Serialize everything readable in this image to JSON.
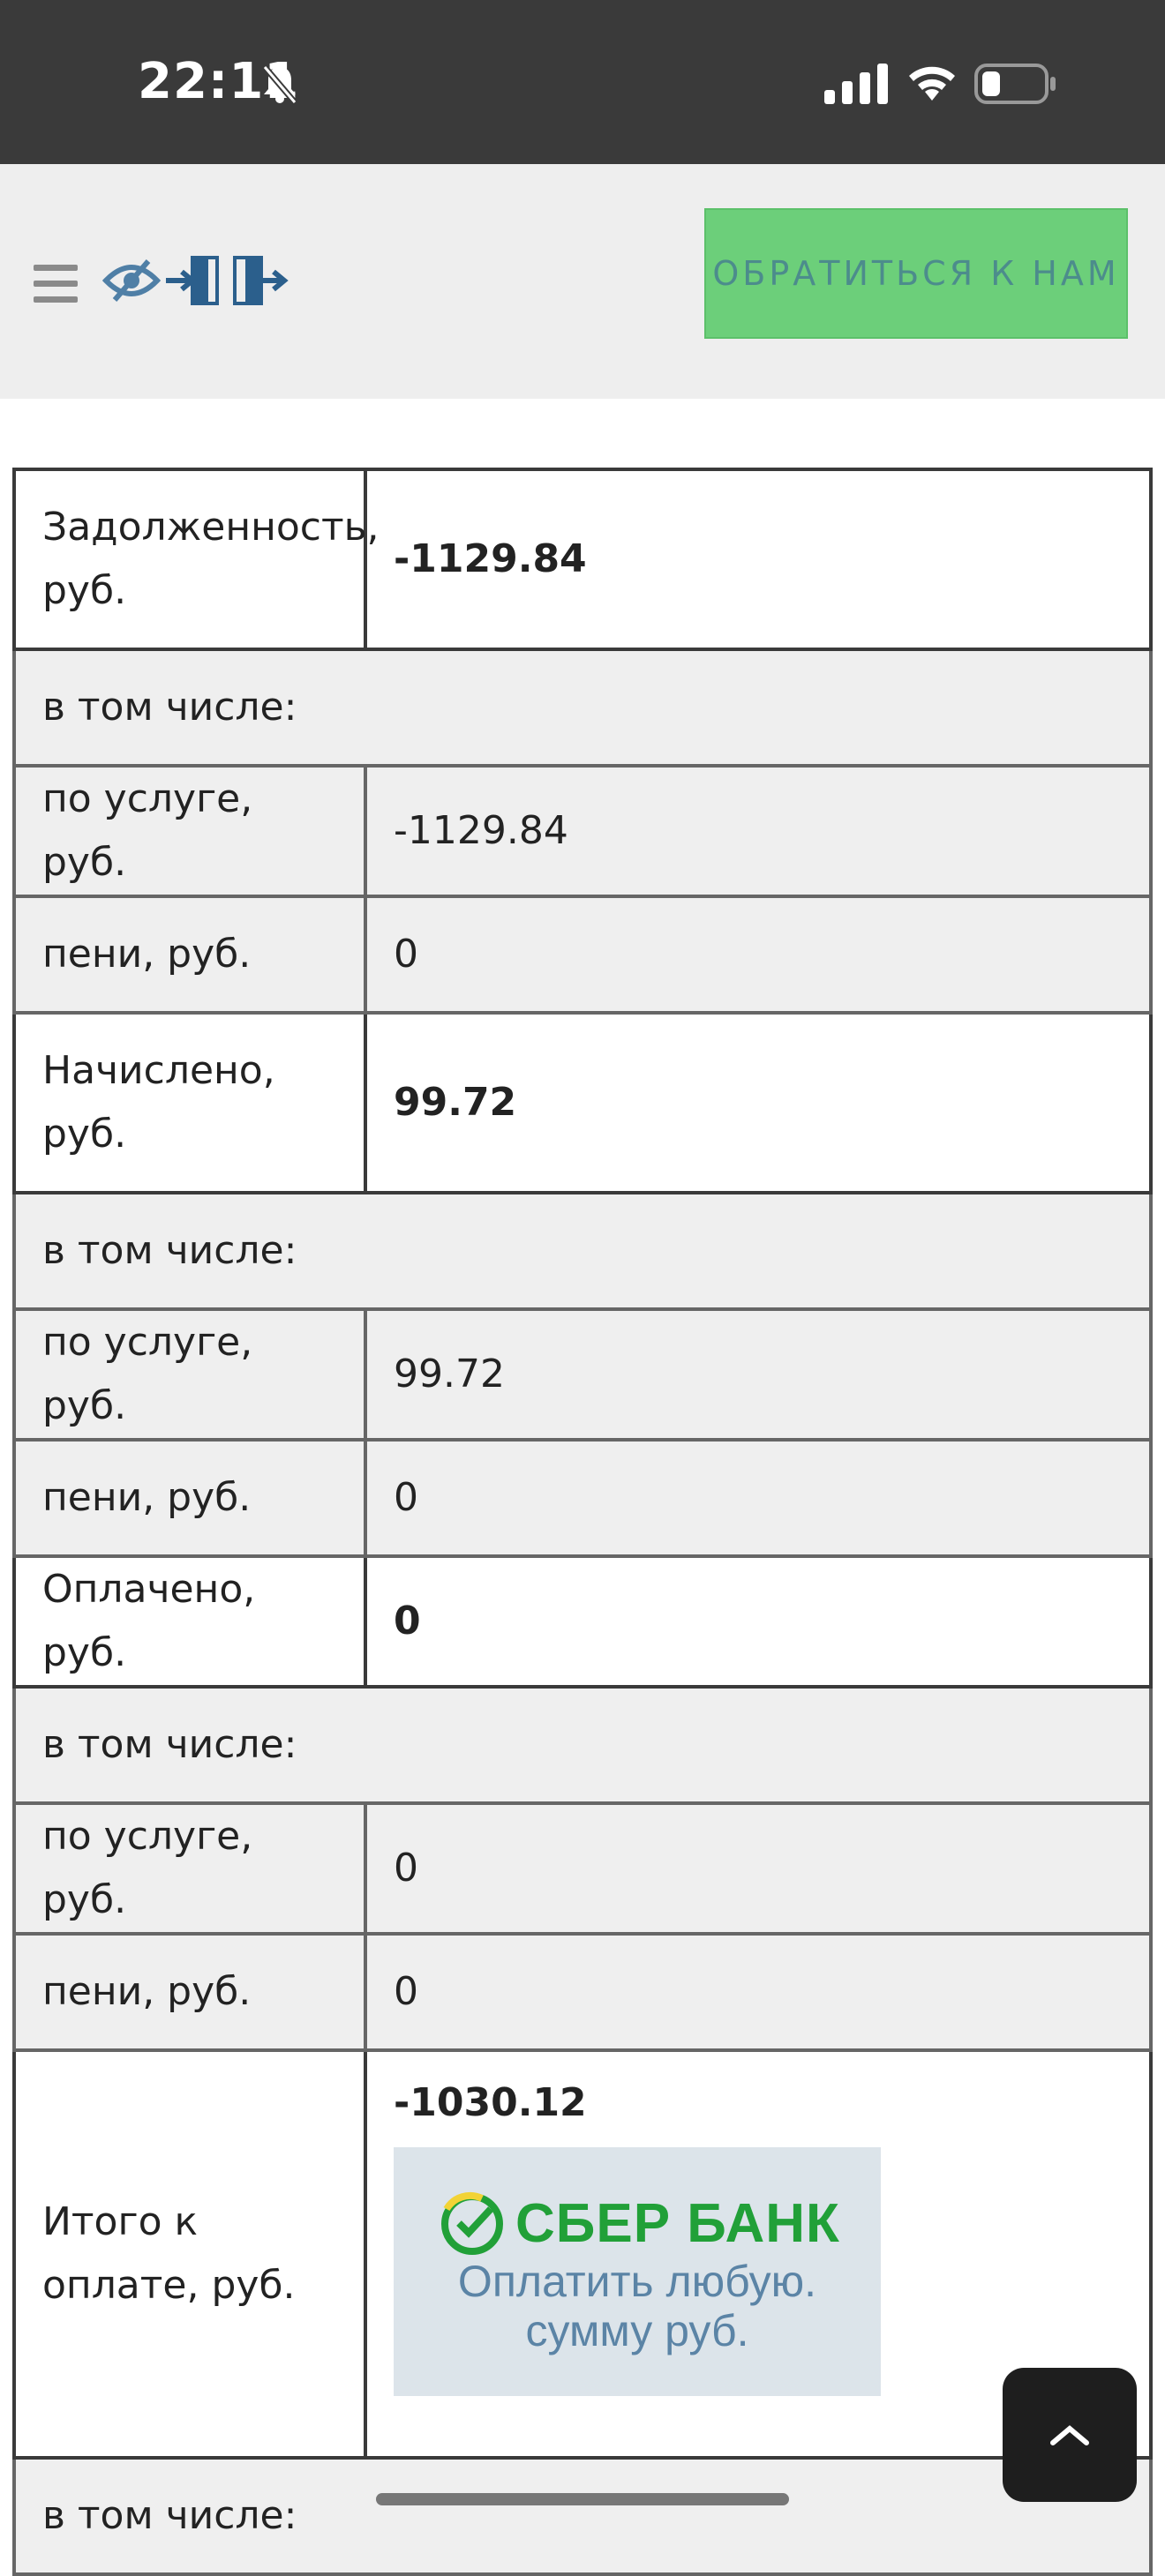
{
  "status_bar": {
    "time": "22:11"
  },
  "header": {
    "contact_button": "ОБРАТИТЬСЯ К НАМ"
  },
  "table": [
    {
      "label": "Задолженность, руб.",
      "value": "-1129.84"
    },
    {
      "label": "в том числе:"
    },
    {
      "label": "по услуге, руб.",
      "value": "-1129.84"
    },
    {
      "label": "пени, руб.",
      "value": "0"
    },
    {
      "label": "Начислено, руб.",
      "value": "99.72"
    },
    {
      "label": "в том числе:"
    },
    {
      "label": "по услуге, руб.",
      "value": "99.72"
    },
    {
      "label": "пени, руб.",
      "value": "0"
    },
    {
      "label": "Оплачено, руб.",
      "value": "0"
    },
    {
      "label": "в том числе:"
    },
    {
      "label": "по услуге, руб.",
      "value": "0"
    },
    {
      "label": "пени, руб.",
      "value": "0"
    },
    {
      "label": "Итого к оплате, руб.",
      "value": "-1030.12"
    },
    {
      "label": "в том числе:"
    }
  ],
  "sber": {
    "brand": "СБЕР БАНК",
    "caption_line1": "Оплатить любую.",
    "caption_line2": "сумму руб."
  },
  "colors": {
    "status_bar_bg": "#3a3a3a",
    "header_bg": "#eeeeee",
    "contact_button_bg": "#6ccf7a",
    "sber_green": "#21a038"
  }
}
